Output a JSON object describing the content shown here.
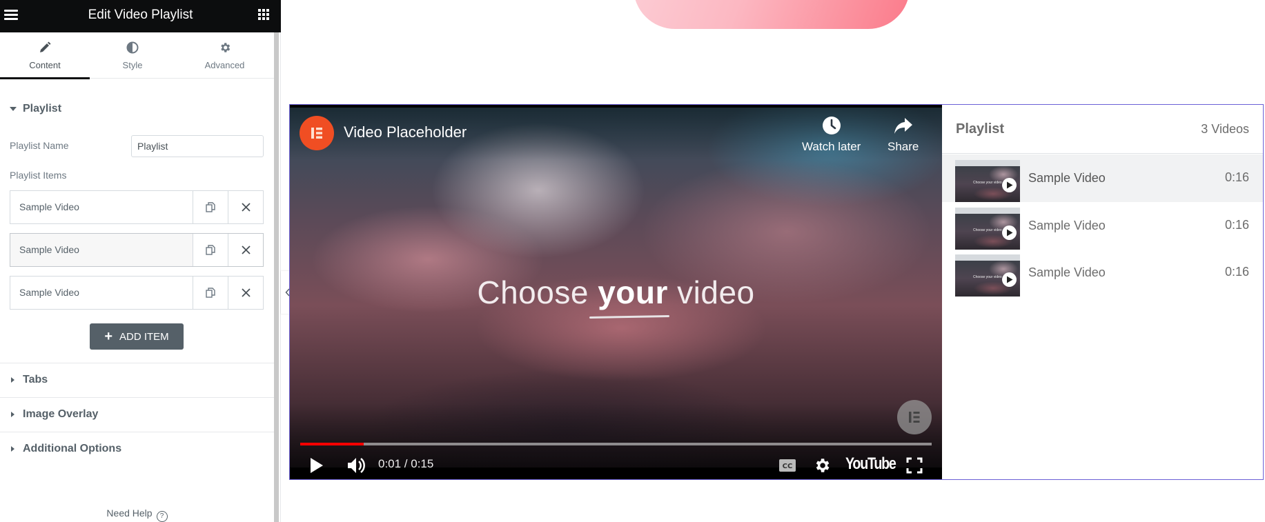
{
  "sidebar": {
    "title": "Edit Video Playlist",
    "menu_icon": "hamburger-icon",
    "apps_icon": "grid-icon",
    "tabs": [
      {
        "label": "Content",
        "icon": "pencil-icon",
        "active": true
      },
      {
        "label": "Style",
        "icon": "half-circle-icon",
        "active": false
      },
      {
        "label": "Advanced",
        "icon": "gear-icon",
        "active": false
      }
    ],
    "playlist_section": {
      "label": "Playlist",
      "expanded": true,
      "name_label": "Playlist Name",
      "name_value": "Playlist",
      "items_label": "Playlist Items",
      "items": [
        {
          "title": "Sample Video"
        },
        {
          "title": "Sample Video"
        },
        {
          "title": "Sample Video"
        }
      ],
      "add_item_label": "ADD ITEM"
    },
    "collapsed_sections": [
      {
        "label": "Tabs"
      },
      {
        "label": "Image Overlay"
      },
      {
        "label": "Additional Options"
      }
    ],
    "need_help": "Need Help",
    "help_icon_glyph": "?"
  },
  "video": {
    "title": "Video Placeholder",
    "center_text_pre": "Choose ",
    "center_text_bold": "your",
    "center_text_post": " video",
    "actions": [
      {
        "label": "Watch later",
        "icon": "clock-icon"
      },
      {
        "label": "Share",
        "icon": "share-arrow-icon"
      }
    ],
    "time_display": "0:01 / 0:15",
    "progress_fraction": 0.1,
    "brand": "YouTube",
    "progress_color": "#ff0000",
    "logo_color": "#f04e23"
  },
  "playlist": {
    "title": "Playlist",
    "count": "3 Videos",
    "items": [
      {
        "title": "Sample Video",
        "duration": "0:16",
        "active": true,
        "thumb_text": "Choose your video"
      },
      {
        "title": "Sample Video",
        "duration": "0:16",
        "active": false,
        "thumb_text": "Choose your video"
      },
      {
        "title": "Sample Video",
        "duration": "0:16",
        "active": false,
        "thumb_text": "Choose your video"
      }
    ],
    "border_color": "#6a5fd6"
  }
}
